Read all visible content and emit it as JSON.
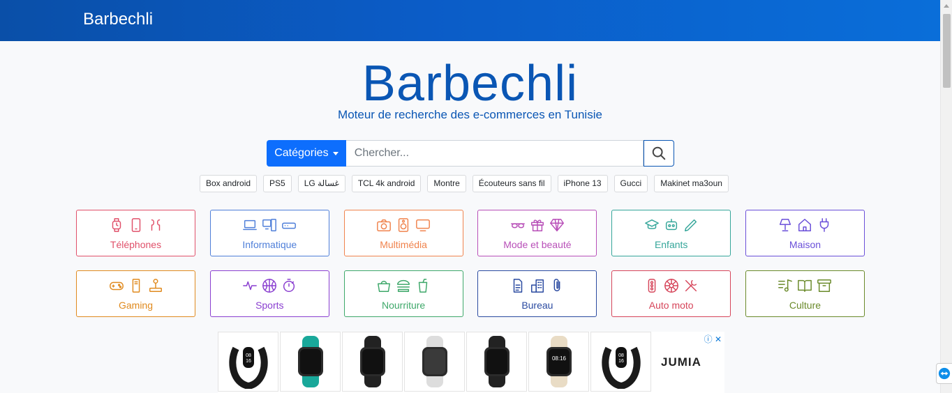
{
  "nav": {
    "brand": "Barbechli"
  },
  "hero": {
    "title": "Barbechli",
    "subtitle": "Moteur de recherche des e-commerces en Tunisie"
  },
  "search": {
    "category_label": "Catégories",
    "placeholder": "Chercher...",
    "search_icon": "search-icon"
  },
  "tags": [
    "Box android",
    "PS5",
    "LG غسالة",
    "TCL 4k android",
    "Montre",
    "Écouteurs sans fil",
    "iPhone 13",
    "Gucci",
    "Makinet ma3oun"
  ],
  "categories": [
    {
      "label": "Téléphones",
      "color": "#e0506a",
      "icons": [
        "smartwatch-icon",
        "smartphone-icon",
        "earbuds-icon"
      ]
    },
    {
      "label": "Informatique",
      "color": "#4f7fd9",
      "icons": [
        "laptop-icon",
        "desktop-icon",
        "router-icon"
      ]
    },
    {
      "label": "Multimédia",
      "color": "#f0834d",
      "icons": [
        "camera-icon",
        "speaker-icon",
        "tv-icon"
      ]
    },
    {
      "label": "Mode et beauté",
      "color": "#b84fb8",
      "icons": [
        "sunglasses-icon",
        "gift-icon",
        "diamond-icon"
      ]
    },
    {
      "label": "Enfants",
      "color": "#35a69a",
      "icons": [
        "graduation-cap-icon",
        "robot-icon",
        "pencil-icon"
      ]
    },
    {
      "label": "Maison",
      "color": "#6a4fd9",
      "icons": [
        "lamp-icon",
        "house-icon",
        "plug-icon"
      ]
    },
    {
      "label": "Gaming",
      "color": "#e08a1e",
      "icons": [
        "gamepad-icon",
        "pc-tower-icon",
        "joystick-icon"
      ]
    },
    {
      "label": "Sports",
      "color": "#8a3fd0",
      "icons": [
        "heartbeat-icon",
        "basketball-icon",
        "stopwatch-icon"
      ]
    },
    {
      "label": "Nourriture",
      "color": "#3ea86a",
      "icons": [
        "basket-icon",
        "burger-icon",
        "drink-cup-icon"
      ]
    },
    {
      "label": "Bureau",
      "color": "#2a4aa0",
      "icons": [
        "document-icon",
        "buildings-icon",
        "paperclip-icon"
      ]
    },
    {
      "label": "Auto moto",
      "color": "#d6455a",
      "icons": [
        "traffic-light-icon",
        "wheel-icon",
        "tools-icon"
      ]
    },
    {
      "label": "Culture",
      "color": "#6a8a2a",
      "icons": [
        "music-icon",
        "book-icon",
        "archive-icon"
      ]
    }
  ],
  "ad": {
    "brand": "JUMIA",
    "products": [
      "smart-band-icon",
      "smartwatch-icon",
      "smartwatch-icon",
      "smartwatch-icon",
      "smartwatch-icon",
      "smartwatch-icon",
      "smart-band-icon"
    ],
    "watch_time": "08:16",
    "band_time": "08\n16"
  },
  "colors": {
    "brand_blue": "#0a56b4",
    "primary": "#0d6efd"
  }
}
